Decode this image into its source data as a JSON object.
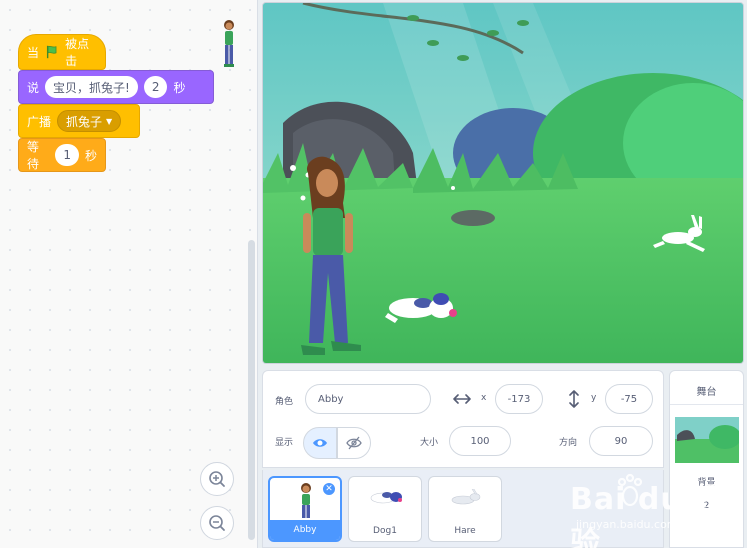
{
  "code": {
    "hat": {
      "prefix": "当",
      "suffix": "被点击",
      "icon": "green-flag-icon"
    },
    "say": {
      "label": "说",
      "message": "宝贝，抓兔子!",
      "seconds": "2",
      "unit": "秒"
    },
    "broadcast": {
      "label": "广播",
      "message": "抓兔子"
    },
    "wait": {
      "label": "等待",
      "seconds": "1",
      "unit": "秒"
    },
    "colors": {
      "events": "#ffbf00",
      "looks": "#9966ff",
      "control": "#ffab19"
    }
  },
  "sprite_info": {
    "sprite_label": "角色",
    "sprite_name": "Abby",
    "x_label": "x",
    "x_value": "-173",
    "y_label": "y",
    "y_value": "-75",
    "show_label": "显示",
    "size_label": "大小",
    "size_value": "100",
    "direction_label": "方向",
    "direction_value": "90"
  },
  "sprites": [
    {
      "name": "Abby",
      "selected": true
    },
    {
      "name": "Dog1",
      "selected": false
    },
    {
      "name": "Hare",
      "selected": false
    }
  ],
  "stage_pane": {
    "title": "舞台",
    "backdrop_label": "背景",
    "backdrop_count": "2"
  },
  "watermark": {
    "brand": "Bai du 经验",
    "url": "jingyan.baidu.com"
  },
  "accent_color": "#4c97ff"
}
